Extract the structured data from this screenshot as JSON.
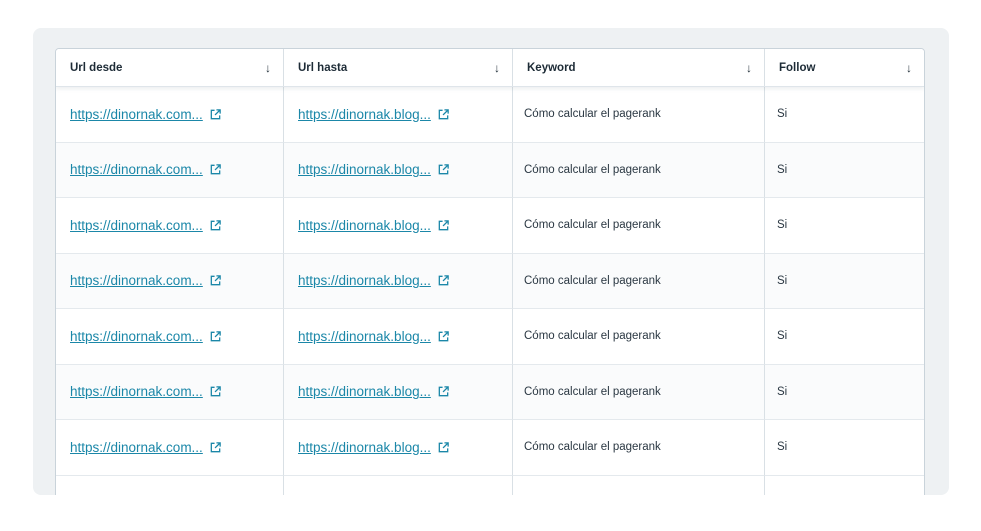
{
  "columns": [
    {
      "label": "Url desde",
      "sort_icon": "arrow-down-icon"
    },
    {
      "label": "Url hasta",
      "sort_icon": "arrow-down-icon"
    },
    {
      "label": "Keyword",
      "sort_icon": "arrow-down-icon"
    },
    {
      "label": "Follow",
      "sort_icon": "arrow-down-icon"
    }
  ],
  "rows": [
    {
      "from": "https://dinornak.com...",
      "to": "https://dinornak.blog...",
      "keyword": "Cómo calcular el pagerank",
      "follow": "Si"
    },
    {
      "from": "https://dinornak.com...",
      "to": "https://dinornak.blog...",
      "keyword": "Cómo calcular el pagerank",
      "follow": "Si"
    },
    {
      "from": "https://dinornak.com...",
      "to": "https://dinornak.blog...",
      "keyword": "Cómo calcular el pagerank",
      "follow": "Si"
    },
    {
      "from": "https://dinornak.com...",
      "to": "https://dinornak.blog...",
      "keyword": "Cómo calcular el pagerank",
      "follow": "Si"
    },
    {
      "from": "https://dinornak.com...",
      "to": "https://dinornak.blog...",
      "keyword": "Cómo calcular el pagerank",
      "follow": "Si"
    },
    {
      "from": "https://dinornak.com...",
      "to": "https://dinornak.blog...",
      "keyword": "Cómo calcular el pagerank",
      "follow": "Si"
    },
    {
      "from": "https://dinornak.com...",
      "to": "https://dinornak.blog...",
      "keyword": "Cómo calcular el pagerank",
      "follow": "Si"
    }
  ],
  "colors": {
    "link": "#1b87a8",
    "header_text": "#1d2b36",
    "card_bg": "#eef1f3"
  },
  "link_icon": "external-link-icon"
}
